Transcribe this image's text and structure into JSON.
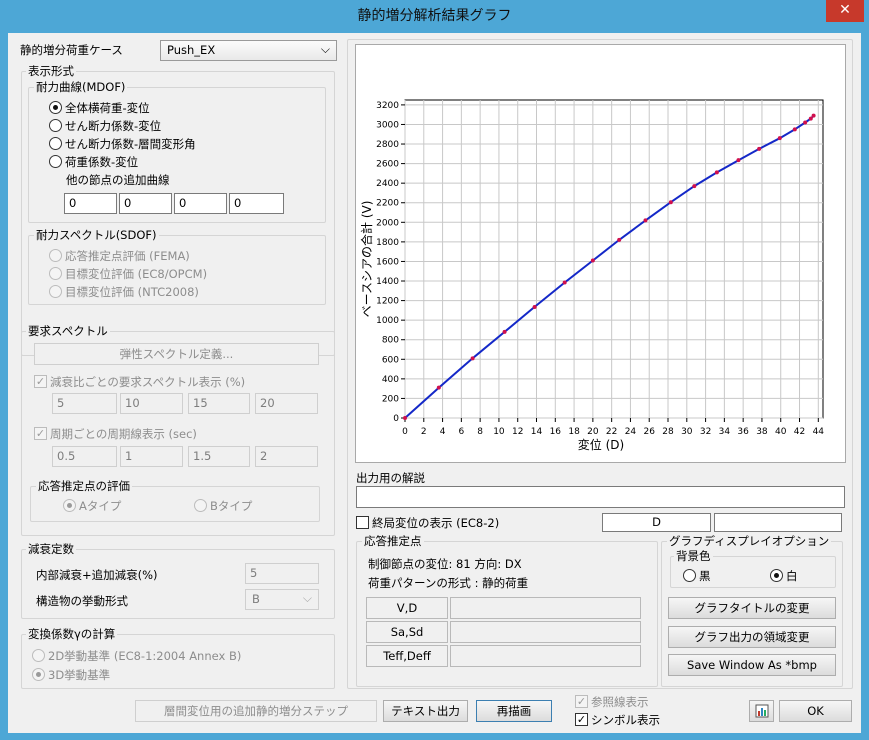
{
  "window": {
    "title": "静的増分解析結果グラフ",
    "close_glyph": "✕"
  },
  "pushover_case": {
    "label": "静的増分荷重ケース",
    "value": "Push_EX"
  },
  "display_format": {
    "title": "表示形式",
    "mdof": {
      "title": "耐力曲線(MDOF)",
      "options": [
        "全体横荷重-変位",
        "せん断力係数-変位",
        "せん断力係数-層間変形角",
        "荷重係数-変位"
      ],
      "selected_index": 0,
      "additional_curve_label": "他の節点の追加曲線",
      "node_inputs": [
        "0",
        "0",
        "0",
        "0"
      ]
    },
    "sdof": {
      "title": "耐力スペクトル(SDOF)",
      "options": [
        "応答推定点評価 (FEMA)",
        "目標変位評価 (EC8/OPCM)",
        "目標変位評価 (NTC2008)"
      ]
    }
  },
  "demand_spectrum": {
    "title": "要求スペクトル",
    "elastic_button": "弾性スペクトル定義...",
    "damping_check_label": "減衰比ごとの要求スペクトル表示 (%)",
    "damping_values": [
      "5",
      "10",
      "15",
      "20"
    ],
    "period_check_label": "周期ごとの周期線表示 (sec)",
    "period_values": [
      "0.5",
      "1",
      "1.5",
      "2"
    ],
    "performance_point": {
      "title": "応答推定点の評価",
      "options": [
        "Aタイプ",
        "Bタイプ"
      ],
      "selected_index": 0
    }
  },
  "damping": {
    "title": "減衰定数",
    "inherent_label": "内部減衰+追加減衰(%)",
    "inherent_value": "5",
    "behavior_label": "構造物の挙動形式",
    "behavior_value": "B"
  },
  "conversion": {
    "title": "変換係数γの計算",
    "options": [
      "2D挙動基準 (EC8-1:2004  Annex B)",
      "3D挙動基準"
    ],
    "selected_index": 1
  },
  "output": {
    "comment_label": "出力用の解説",
    "comment_value": "",
    "final_disp_label": "終局変位の表示 (EC8-2)",
    "final_disp_field": "D",
    "final_disp_value": ""
  },
  "performance": {
    "title": "応答推定点",
    "control_node": "制御節点の変位: 81  方向: DX",
    "load_pattern": "荷重パターンの形式 : 静的荷重",
    "rows": [
      {
        "label": "V,D",
        "value": ""
      },
      {
        "label": "Sa,Sd",
        "value": ""
      },
      {
        "label": "Teff,Deff",
        "value": ""
      }
    ]
  },
  "graph_options": {
    "title": "グラフディスプレイオプション",
    "bg_title": "背景色",
    "bg_options": [
      "黒",
      "白"
    ],
    "bg_selected_index": 1,
    "title_button": "グラフタイトルの変更",
    "region_button": "グラフ出力の領域変更",
    "save_button": "Save Window As *bmp"
  },
  "bottom": {
    "extra_step_button": "層間変位用の追加静的増分ステップ",
    "text_output_button": "テキスト出力",
    "redraw_button": "再描画",
    "reference_line_label": "参照線表示",
    "symbol_label": "シンボル表示",
    "ok_button": "OK"
  },
  "colors": {
    "curve": "#1428c8",
    "markers": "#d0104e",
    "grid": "#c8c8c8",
    "title_bar": "#4da7d6",
    "close": "#c7392b"
  },
  "icons": {
    "close": "close-icon",
    "chart_icon": "bar-chart-icon",
    "dropdown": "chevron-down-icon"
  },
  "chart_data": {
    "type": "line",
    "xlabel": "変位 (D)",
    "ylabel": "ベースシアの合計 (V)",
    "xlim": [
      0,
      44.5
    ],
    "ylim": [
      0,
      3250
    ],
    "xticks": [
      0,
      2,
      4,
      6,
      8,
      10,
      12,
      14,
      16,
      18,
      20,
      22,
      24,
      26,
      28,
      30,
      32,
      34,
      36,
      38,
      40,
      42,
      44
    ],
    "yticks": [
      0,
      200,
      400,
      600,
      800,
      1000,
      1200,
      1400,
      1600,
      1800,
      2000,
      2200,
      2400,
      2600,
      2800,
      3000,
      3200
    ],
    "grid": true,
    "series": [
      {
        "x": [
          0,
          3.6,
          7.2,
          10.6,
          13.8,
          17.0,
          20.0,
          22.8,
          25.6,
          28.3,
          30.8,
          33.2,
          35.5,
          37.7,
          39.9,
          41.5,
          42.6,
          43.2,
          43.5
        ],
        "y": [
          0,
          310,
          610,
          880,
          1135,
          1385,
          1610,
          1820,
          2020,
          2205,
          2370,
          2510,
          2635,
          2750,
          2860,
          2950,
          3020,
          3060,
          3090
        ]
      }
    ]
  }
}
